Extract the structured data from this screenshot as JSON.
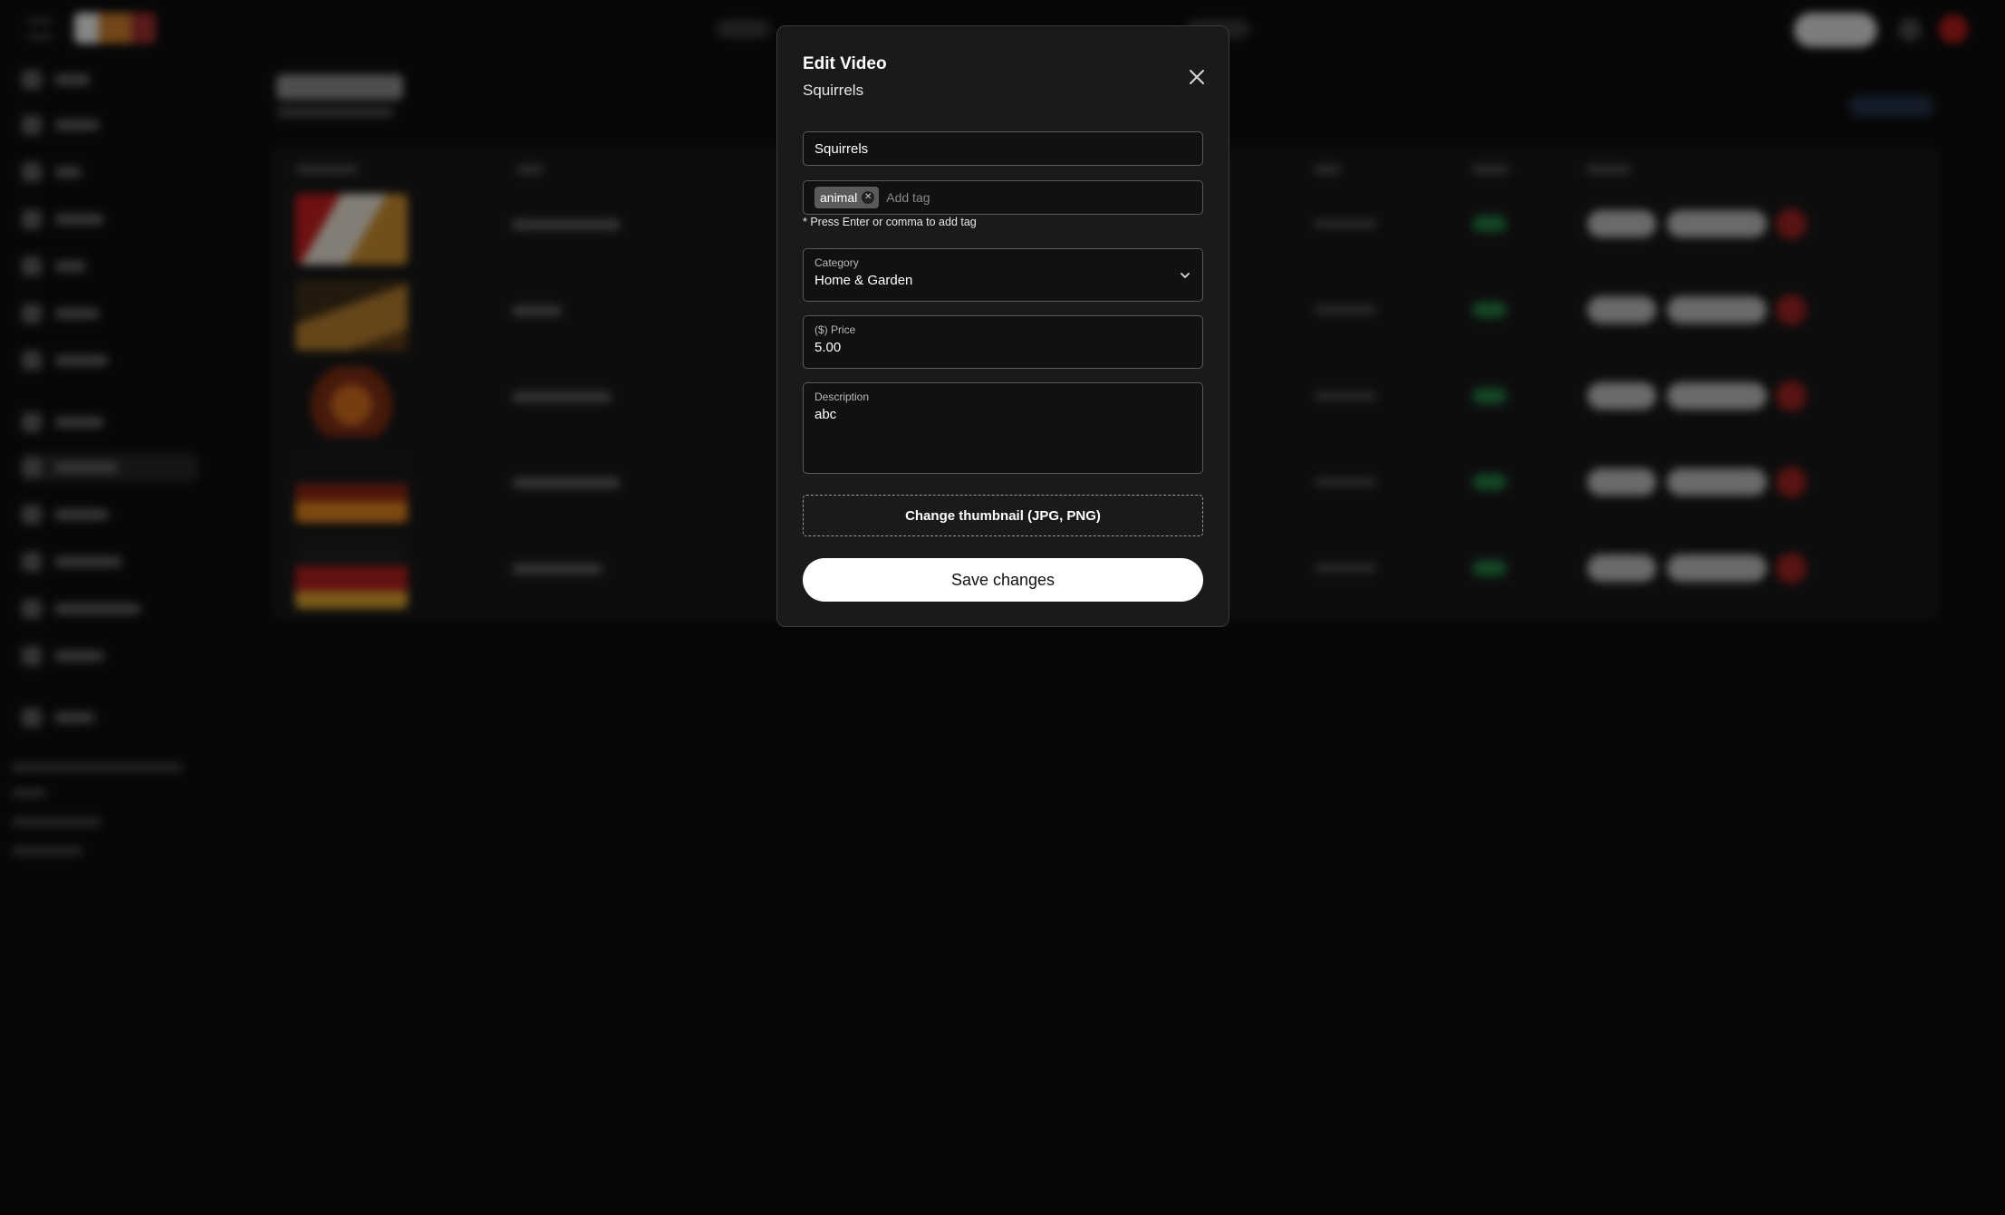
{
  "modal": {
    "title": "Edit Video",
    "subtitle": "Squirrels",
    "close_icon": "close-icon",
    "fields": {
      "title_value": "Squirrels",
      "tags": [
        "animal"
      ],
      "tag_placeholder": "Add tag",
      "tags_hint": "* Press Enter or comma to add tag",
      "category_label": "Category",
      "category_value": "Home & Garden",
      "price_label": "($) Price",
      "price_value": "5.00",
      "description_label": "Description",
      "description_value": "abc"
    },
    "thumbnail_button": "Change thumbnail (JPG, PNG)",
    "save_button": "Save changes"
  },
  "colors": {
    "backdrop": "#070707",
    "modal_bg": "#1a1a1a",
    "field_border": "#5a5a5a",
    "save_bg": "#ffffff",
    "status_green": "#1f7a3d",
    "danger_red": "#9b1d1d"
  }
}
